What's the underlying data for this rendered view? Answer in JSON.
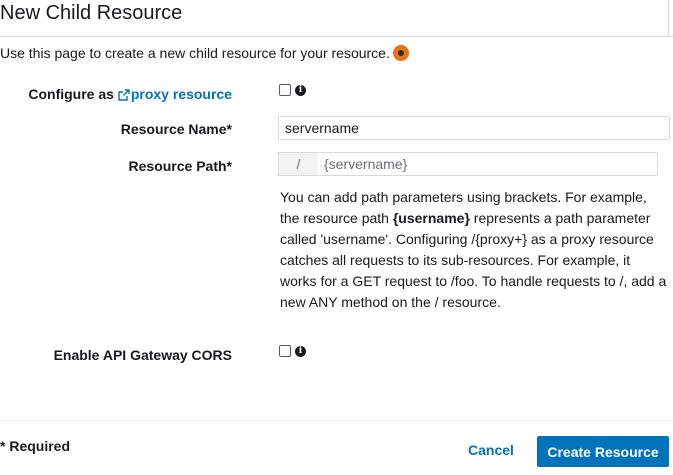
{
  "header": {
    "title": "New Child Resource"
  },
  "intro": {
    "text": "Use this page to create a new child resource for your resource."
  },
  "form": {
    "proxy": {
      "label_prefix": "Configure as ",
      "link_text": "proxy resource",
      "checked": false
    },
    "resource_name": {
      "label": "Resource Name*",
      "value": "servername"
    },
    "resource_path": {
      "label": "Resource Path*",
      "prefix": "/",
      "placeholder": "{servername}"
    },
    "help": {
      "part1": "You can add path parameters using brackets. For example, the resource path ",
      "bold": "{username}",
      "part2": " represents a path parameter called 'username'. Configuring /{proxy+} as a proxy resource catches all requests to its sub-resources. For example, it works for a GET request to /foo. To handle requests to /, add a new ANY method on the / resource."
    },
    "cors": {
      "label": "Enable API Gateway CORS",
      "checked": false
    }
  },
  "footer": {
    "required_note": "* Required",
    "cancel_label": "Cancel",
    "create_label": "Create Resource"
  },
  "colors": {
    "link": "#0073bb",
    "primary_button": "#0073bb",
    "status_dot": "#ec7211"
  }
}
